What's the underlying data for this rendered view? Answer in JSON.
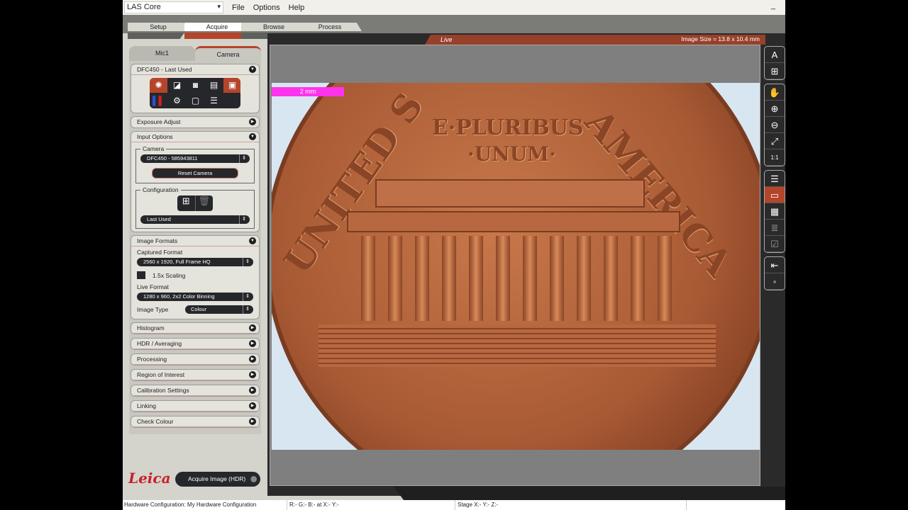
{
  "app": {
    "selector": "LAS Core",
    "menu": [
      "File",
      "Options",
      "Help"
    ],
    "minimize": "_"
  },
  "workflow_tabs": [
    "Setup",
    "Acquire",
    "Browse",
    "Process"
  ],
  "panel_tabs": [
    "Mic1",
    "Camera"
  ],
  "camera_section": {
    "title": "DFC450 - Last Used"
  },
  "sections": {
    "exposure": "Exposure Adjust",
    "input": "Input Options",
    "formats": "Image Formats"
  },
  "input_options": {
    "camera_legend": "Camera",
    "camera_value": "DFC450 - 585943811",
    "reset": "Reset Camera",
    "config_legend": "Configuration",
    "config_value": "Last Used"
  },
  "image_formats": {
    "captured_label": "Captured Format",
    "captured_value": "2560 x 1920,    Full Frame HQ",
    "scaling": "1.5x Scaling",
    "live_label": "Live Format",
    "live_value": "1280 x 960,    2x2 Color Binning",
    "type_label": "Image Type",
    "type_value": "Colour"
  },
  "collapsed_sections": [
    "Histogram",
    "HDR / Averaging",
    "Processing",
    "Region of Interest",
    "Calibration Settings",
    "Linking",
    "Check Colour"
  ],
  "viewer": {
    "live": "Live",
    "image_size": "Image Size = 13.8 x 10.4 mm",
    "scale_bar": "2 mm"
  },
  "coin_text": {
    "motto1": "E·PLURIBUS",
    "motto2": "·UNUM·",
    "left": "UNITED S",
    "right": "AMERICA"
  },
  "bottom": {
    "logo": "Leica",
    "acquire": "Acquire Image (HDR)"
  },
  "status": {
    "hardware": "Hardware Configuration: My Hardware Configuration",
    "rgb": "R:-  G:-  B:-  at  X:-  Y:-",
    "stage": "Stage X:-  Y:-  Z:-"
  },
  "colors": {
    "accent": "#b5452a",
    "scale_bar": "#ff33ee"
  }
}
